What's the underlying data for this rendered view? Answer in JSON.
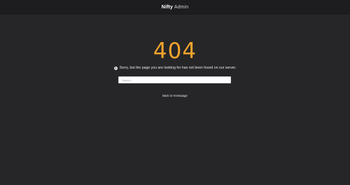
{
  "header": {
    "brand_bold": "Nifty",
    "brand_light": "Admin"
  },
  "error": {
    "code": "404",
    "message": "Sorry, but the page you are looking for has not been found on our server.",
    "message_icon": "info-circle-icon"
  },
  "search": {
    "placeholder": "Search...",
    "value": ""
  },
  "back_link": {
    "label": "Back to Homepage"
  },
  "colors": {
    "background": "#262628",
    "topbar": "#1d1d1f",
    "accent": "#f3a42c"
  }
}
